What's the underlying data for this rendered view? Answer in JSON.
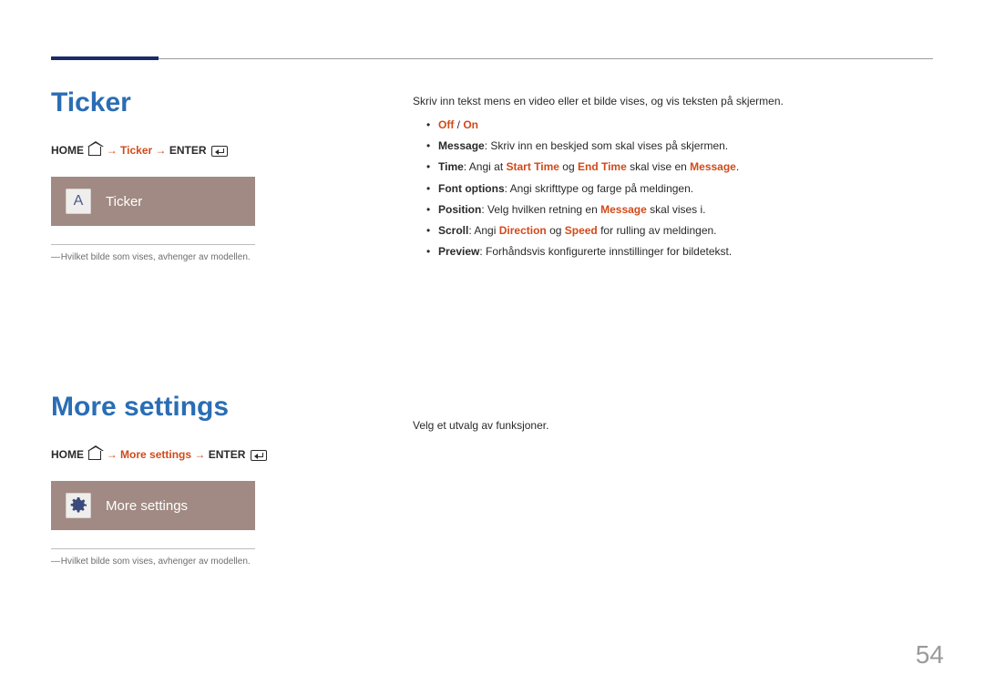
{
  "page_number": "54",
  "section1": {
    "heading": "Ticker",
    "breadcrumb": {
      "home": "HOME",
      "arrow": "→",
      "mid": "Ticker",
      "enter": "ENTER"
    },
    "tile_label": "Ticker",
    "tile_icon_letter": "A",
    "footnote": "Hvilket bilde som vises, avhenger av modellen.",
    "right_intro": "Skriv inn tekst mens en video eller et bilde vises, og vis teksten på skjermen.",
    "bullets": {
      "b0": {
        "accent": "Off",
        "sep": " / ",
        "accent2": "On"
      },
      "b1": {
        "bold": "Message",
        "text": ": Skriv inn en beskjed som skal vises på skjermen."
      },
      "b2": {
        "bold": "Time",
        "t1": ": Angi at ",
        "a1": "Start Time",
        "t2": " og ",
        "a2": "End Time",
        "t3": " skal vise en ",
        "a3": "Message",
        "t4": "."
      },
      "b3": {
        "bold": "Font options",
        "text": ": Angi skrifttype og farge på meldingen."
      },
      "b4": {
        "bold": "Position",
        "t1": ": Velg hvilken retning en ",
        "a1": "Message",
        "t2": " skal vises i."
      },
      "b5": {
        "bold": "Scroll",
        "t1": ": Angi ",
        "a1": "Direction",
        "t2": " og ",
        "a2": "Speed",
        "t3": " for rulling av meldingen."
      },
      "b6": {
        "bold": "Preview",
        "text": ": Forhåndsvis konfigurerte innstillinger for bildetekst."
      }
    }
  },
  "section2": {
    "heading": "More settings",
    "breadcrumb": {
      "home": "HOME",
      "arrow": "→",
      "mid": "More settings",
      "enter": "ENTER"
    },
    "tile_label": "More settings",
    "footnote": "Hvilket bilde som vises, avhenger av modellen.",
    "right_intro": "Velg et utvalg av funksjoner."
  }
}
